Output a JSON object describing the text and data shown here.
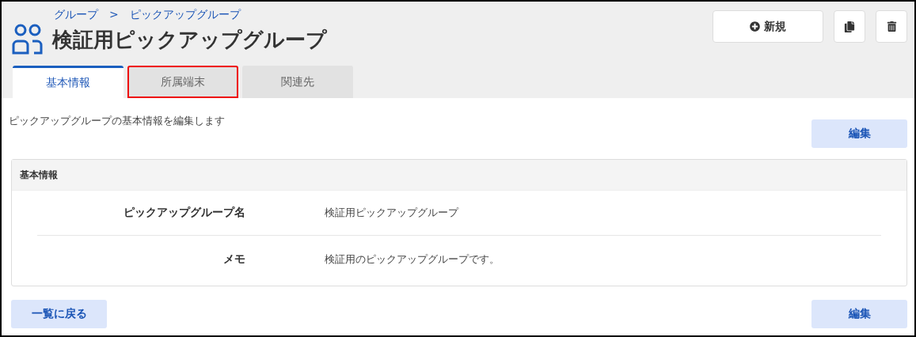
{
  "breadcrumb": [
    "グループ",
    "ピックアップグループ"
  ],
  "breadcrumb_separator": ">",
  "title": "検証用ピックアップグループ",
  "actions": {
    "new_label": "新規"
  },
  "tabs": [
    {
      "label": "基本情報",
      "selected": true,
      "highlighted": false
    },
    {
      "label": "所属端末",
      "selected": false,
      "highlighted": true
    },
    {
      "label": "関連先",
      "selected": false,
      "highlighted": false
    }
  ],
  "description": "ピックアップグループの基本情報を編集します",
  "edit_button": "編集",
  "panel": {
    "title": "基本情報",
    "fields": [
      {
        "label": "ピックアップグループ名",
        "value": "検証用ピックアップグループ"
      },
      {
        "label": "メモ",
        "value": "検証用のピックアップグループです。"
      }
    ]
  },
  "footer": {
    "back_button": "一覧に戻る",
    "edit_button": "編集"
  }
}
